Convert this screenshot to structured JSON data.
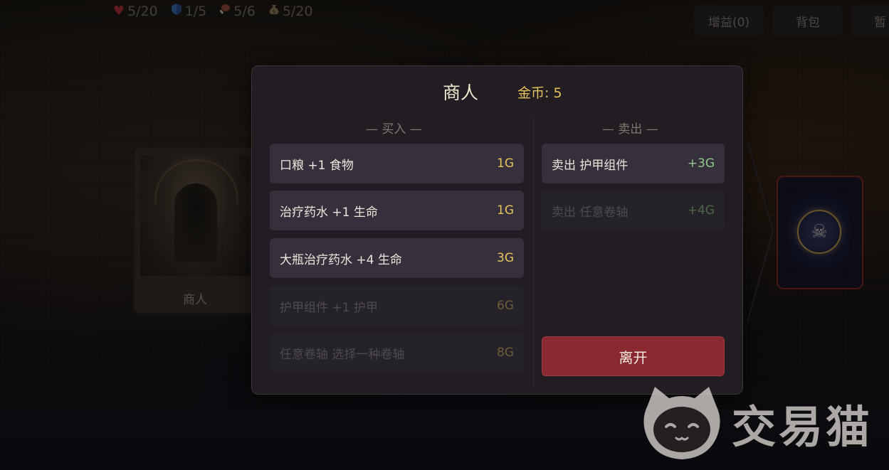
{
  "hud": {
    "health": "5/20",
    "armor": "1/5",
    "food": "5/6",
    "gold": "5/20",
    "buttons": {
      "buff": "增益(0)",
      "bag": "背包",
      "pause": "暂"
    }
  },
  "scene": {
    "current_card_label": "商人"
  },
  "shop": {
    "title": "商人",
    "gold_label": "金币: 5",
    "buy_header": "— 买入 —",
    "sell_header": "— 卖出 —",
    "buy_items": [
      {
        "label": "口粮 +1 食物",
        "price": "1G",
        "enabled": true
      },
      {
        "label": "治疗药水 +1 生命",
        "price": "1G",
        "enabled": true
      },
      {
        "label": "大瓶治疗药水 +4 生命",
        "price": "3G",
        "enabled": true
      },
      {
        "label": "护甲组件 +1 护甲",
        "price": "6G",
        "enabled": false
      },
      {
        "label": "任意卷轴 选择一种卷轴",
        "price": "8G",
        "enabled": false
      }
    ],
    "sell_items": [
      {
        "label": "卖出 护甲组件",
        "price": "+3G",
        "enabled": true
      },
      {
        "label": "卖出 任意卷轴",
        "price": "+4G",
        "enabled": false
      }
    ],
    "leave_label": "离开"
  },
  "watermark": {
    "text": "交易猫"
  },
  "colors": {
    "accent_gold": "#e4c15a",
    "sell_green": "#8fc98a",
    "leave_red": "#8a2a30",
    "health_red": "#b8353c",
    "armor_blue": "#3e6fb4"
  },
  "icons": [
    "heart-icon",
    "shield-icon",
    "meat-icon",
    "money-bag-icon",
    "skull-icon"
  ]
}
